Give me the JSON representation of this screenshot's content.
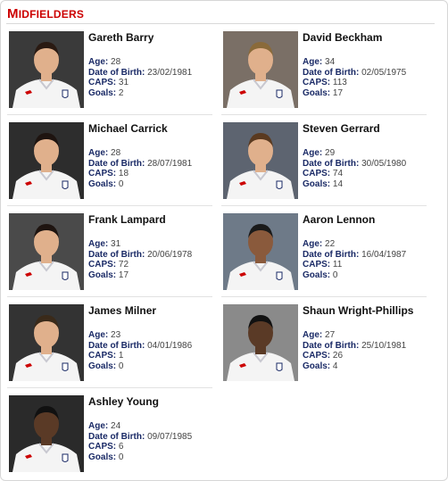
{
  "section": {
    "title_first": "M",
    "title_rest": "IDFIELDERS"
  },
  "labels": {
    "age": "Age:",
    "dob": "Date of Birth:",
    "caps": "CAPS:",
    "goals": "Goals:"
  },
  "players": [
    {
      "name": "Gareth Barry",
      "age": "28",
      "dob": "23/02/1981",
      "caps": "31",
      "goals": "2"
    },
    {
      "name": "David Beckham",
      "age": "34",
      "dob": "02/05/1975",
      "caps": "113",
      "goals": "17"
    },
    {
      "name": "Michael Carrick",
      "age": "28",
      "dob": "28/07/1981",
      "caps": "18",
      "goals": "0"
    },
    {
      "name": "Steven Gerrard",
      "age": "29",
      "dob": "30/05/1980",
      "caps": "74",
      "goals": "14"
    },
    {
      "name": "Frank Lampard",
      "age": "31",
      "dob": "20/06/1978",
      "caps": "72",
      "goals": "17"
    },
    {
      "name": "Aaron Lennon",
      "age": "22",
      "dob": "16/04/1987",
      "caps": "11",
      "goals": "0"
    },
    {
      "name": "James Milner",
      "age": "23",
      "dob": "04/01/1986",
      "caps": "1",
      "goals": "0"
    },
    {
      "name": "Shaun Wright-Phillips",
      "age": "27",
      "dob": "25/10/1981",
      "caps": "26",
      "goals": "4"
    },
    {
      "name": "Ashley Young",
      "age": "24",
      "dob": "09/07/1985",
      "caps": "6",
      "goals": "0"
    }
  ],
  "colors": {
    "heading": "#cc0000",
    "label": "#1a2a66",
    "shirt": "#f4f4f4",
    "skin_light": "#e0b08c",
    "skin_dark": "#5a3a26"
  }
}
